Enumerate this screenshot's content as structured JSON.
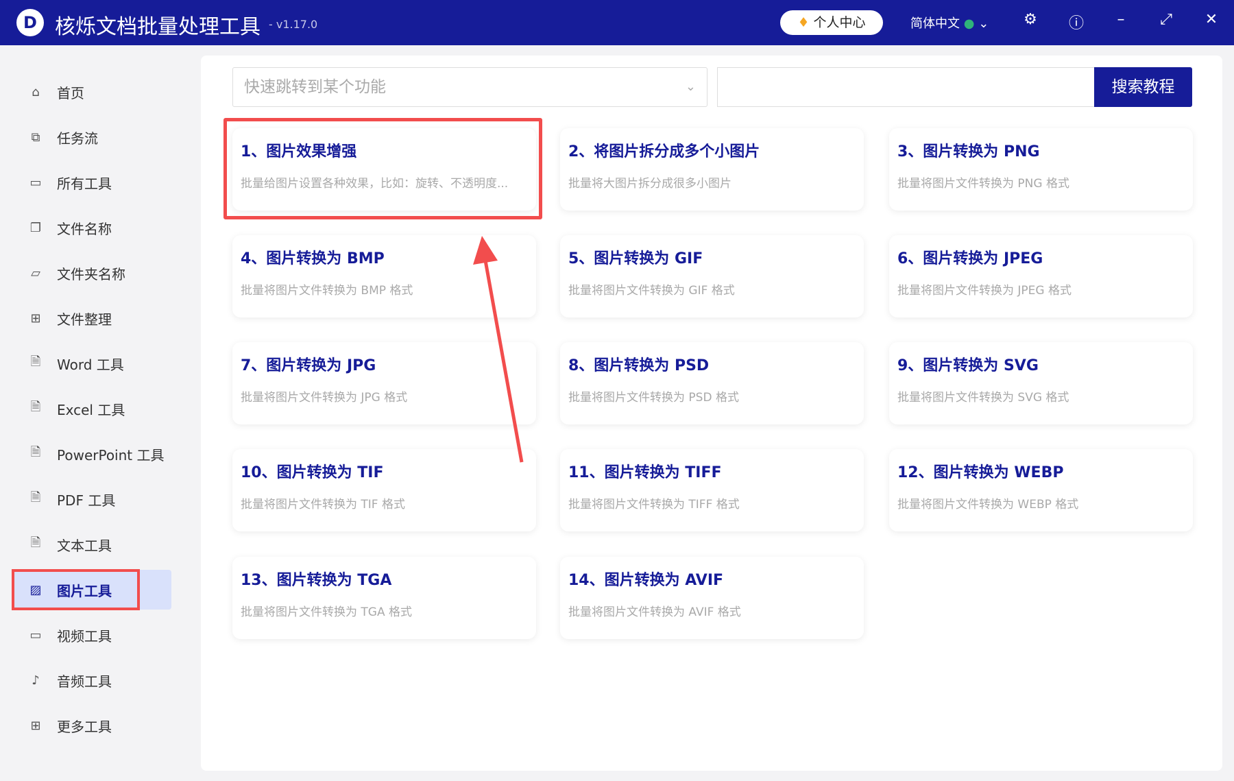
{
  "titlebar": {
    "title": "核烁文档批量处理工具",
    "version": "- v1.17.0",
    "user_center": "个人中心",
    "language": "简体中文"
  },
  "sidebar": {
    "items": [
      {
        "label": "首页",
        "icon": "home-icon",
        "glyph": "⌂"
      },
      {
        "label": "任务流",
        "icon": "workflow-icon",
        "glyph": "⧉"
      },
      {
        "label": "所有工具",
        "icon": "monitor-icon",
        "glyph": "▭"
      },
      {
        "label": "文件名称",
        "icon": "file-copy-icon",
        "glyph": "❐"
      },
      {
        "label": "文件夹名称",
        "icon": "folder-icon",
        "glyph": "▱"
      },
      {
        "label": "文件整理",
        "icon": "organize-icon",
        "glyph": "⊞"
      },
      {
        "label": "Word 工具",
        "icon": "word-icon",
        "glyph": "🗎"
      },
      {
        "label": "Excel 工具",
        "icon": "excel-icon",
        "glyph": "🗎"
      },
      {
        "label": "PowerPoint 工具",
        "icon": "powerpoint-icon",
        "glyph": "🗎"
      },
      {
        "label": "PDF 工具",
        "icon": "pdf-icon",
        "glyph": "🗎"
      },
      {
        "label": "文本工具",
        "icon": "text-icon",
        "glyph": "🗎"
      },
      {
        "label": "图片工具",
        "icon": "image-icon",
        "glyph": "▨"
      },
      {
        "label": "视频工具",
        "icon": "video-icon",
        "glyph": "▭"
      },
      {
        "label": "音频工具",
        "icon": "microphone-icon",
        "glyph": "♪"
      },
      {
        "label": "更多工具",
        "icon": "grid-icon",
        "glyph": "⊞"
      }
    ],
    "active_index": 11
  },
  "search": {
    "dropdown_placeholder": "快速跳转到某个功能",
    "button": "搜索教程"
  },
  "tools": [
    {
      "title": "1、图片效果增强",
      "desc": "批量给图片设置各种效果，比如：旋转、不透明度..."
    },
    {
      "title": "2、将图片拆分成多个小图片",
      "desc": "批量将大图片拆分成很多小图片"
    },
    {
      "title": "3、图片转换为 PNG",
      "desc": "批量将图片文件转换为 PNG 格式"
    },
    {
      "title": "4、图片转换为 BMP",
      "desc": "批量将图片文件转换为 BMP 格式"
    },
    {
      "title": "5、图片转换为 GIF",
      "desc": "批量将图片文件转换为 GIF 格式"
    },
    {
      "title": "6、图片转换为 JPEG",
      "desc": "批量将图片文件转换为 JPEG 格式"
    },
    {
      "title": "7、图片转换为 JPG",
      "desc": "批量将图片文件转换为 JPG 格式"
    },
    {
      "title": "8、图片转换为 PSD",
      "desc": "批量将图片文件转换为 PSD 格式"
    },
    {
      "title": "9、图片转换为 SVG",
      "desc": "批量将图片文件转换为 SVG 格式"
    },
    {
      "title": "10、图片转换为 TIF",
      "desc": "批量将图片文件转换为 TIF 格式"
    },
    {
      "title": "11、图片转换为 TIFF",
      "desc": "批量将图片文件转换为 TIFF 格式"
    },
    {
      "title": "12、图片转换为 WEBP",
      "desc": "批量将图片文件转换为 WEBP 格式"
    },
    {
      "title": "13、图片转换为 TGA",
      "desc": "批量将图片文件转换为 TGA 格式"
    },
    {
      "title": "14、图片转换为 AVIF",
      "desc": "批量将图片文件转换为 AVIF 格式"
    }
  ],
  "colors": {
    "brand": "#161c98",
    "highlight": "#f24d4d"
  }
}
